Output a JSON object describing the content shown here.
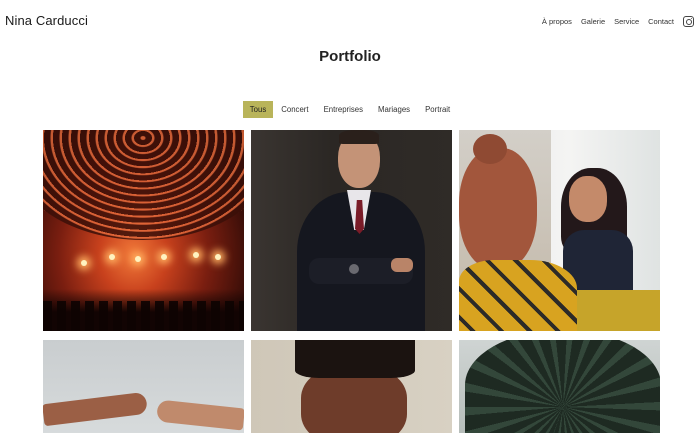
{
  "site": {
    "title": "Nina Carducci"
  },
  "nav": {
    "items": [
      {
        "label": "À propos"
      },
      {
        "label": "Galerie"
      },
      {
        "label": "Service"
      },
      {
        "label": "Contact"
      }
    ],
    "social_icon": "instagram-icon"
  },
  "page": {
    "title": "Portfolio"
  },
  "filters": {
    "items": [
      {
        "label": "Tous",
        "active": true
      },
      {
        "label": "Concert",
        "active": false
      },
      {
        "label": "Entreprises",
        "active": false
      },
      {
        "label": "Mariages",
        "active": false
      },
      {
        "label": "Portrait",
        "active": false
      }
    ],
    "active_color": "#b9b45a"
  },
  "gallery": {
    "photos": [
      {
        "subject": "concert"
      },
      {
        "subject": "businessman"
      },
      {
        "subject": "office-meeting"
      },
      {
        "subject": "hands"
      },
      {
        "subject": "portrait-face"
      },
      {
        "subject": "palm-tree"
      }
    ]
  }
}
